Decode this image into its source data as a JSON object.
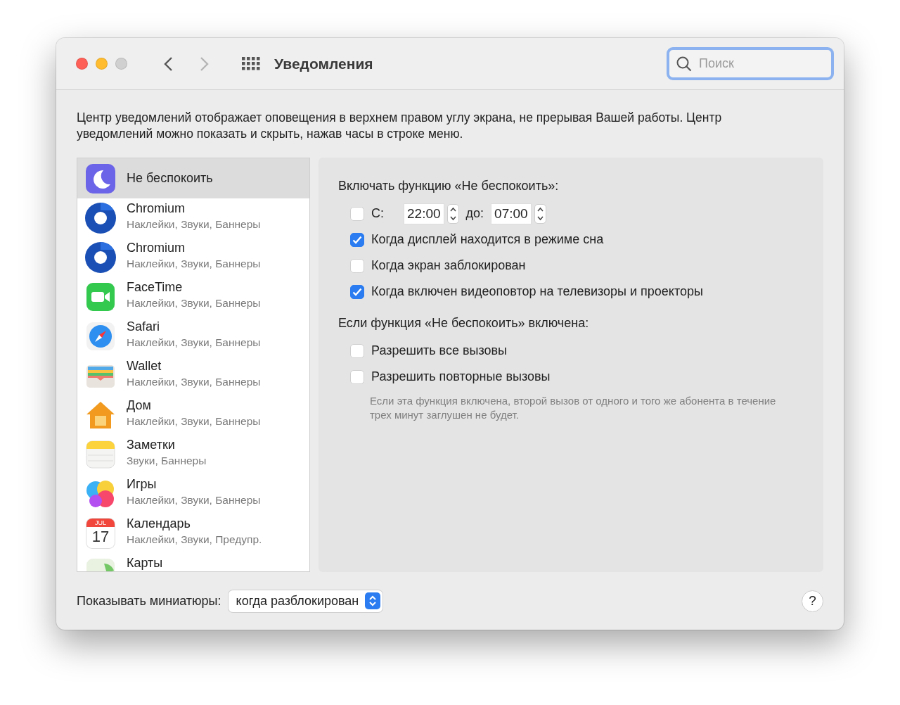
{
  "window": {
    "title": "Уведомления"
  },
  "search": {
    "placeholder": "Поиск"
  },
  "description": "Центр уведомлений отображает оповещения в верхнем правом углу экрана, не прерывая Вашей работы. Центр уведомлений можно показать и скрыть, нажав часы в строке меню.",
  "apps": [
    {
      "kind": "moon",
      "name": "Не беспокоить",
      "selected": true
    },
    {
      "kind": "chromium",
      "name": "Chromium",
      "detail": "Наклейки, Звуки, Баннеры",
      "selected": false
    },
    {
      "kind": "chromium",
      "name": "Chromium",
      "detail": "Наклейки, Звуки, Баннеры",
      "selected": false
    },
    {
      "kind": "facetime",
      "name": "FaceTime",
      "detail": "Наклейки, Звуки, Баннеры",
      "selected": false
    },
    {
      "kind": "safari",
      "name": "Safari",
      "detail": "Наклейки, Звуки, Баннеры",
      "selected": false
    },
    {
      "kind": "wallet",
      "name": "Wallet",
      "detail": "Наклейки, Звуки, Баннеры",
      "selected": false
    },
    {
      "kind": "home",
      "name": "Дом",
      "detail": "Наклейки, Звуки, Баннеры",
      "selected": false
    },
    {
      "kind": "notes",
      "name": "Заметки",
      "detail": "Звуки, Баннеры",
      "selected": false
    },
    {
      "kind": "games",
      "name": "Игры",
      "detail": "Наклейки, Звуки, Баннеры",
      "selected": false
    },
    {
      "kind": "calendar",
      "name": "Календарь",
      "detail": "Наклейки, Звуки, Предупр.",
      "selected": false,
      "month": "JUL",
      "day": "17"
    },
    {
      "kind": "maps",
      "name": "Карты",
      "selected": false
    }
  ],
  "schedule": {
    "heading": "Включать функцию «Не беспокоить»:",
    "options": [
      {
        "kind": "time",
        "checked": false,
        "label": "С:",
        "from": "22:00",
        "to_label": "до:",
        "to": "07:00"
      },
      {
        "kind": "check",
        "checked": true,
        "label": "Когда дисплей находится в режиме сна"
      },
      {
        "kind": "check",
        "checked": false,
        "label": "Когда экран заблокирован"
      },
      {
        "kind": "check",
        "checked": true,
        "label": "Когда включен видеоповтор на телевизоры и проекторы"
      }
    ]
  },
  "when_on": {
    "heading": "Если функция «Не беспокоить» включена:",
    "options": [
      {
        "checked": false,
        "label": "Разрешить все вызовы"
      },
      {
        "checked": false,
        "label": "Разрешить повторные вызовы"
      }
    ],
    "note": "Если эта функция включена, второй вызов от одного и того же абонента в течение трех минут заглушен не будет."
  },
  "previews": {
    "label": "Показывать миниатюры:",
    "value": "когда разблокирован"
  },
  "help": "?"
}
